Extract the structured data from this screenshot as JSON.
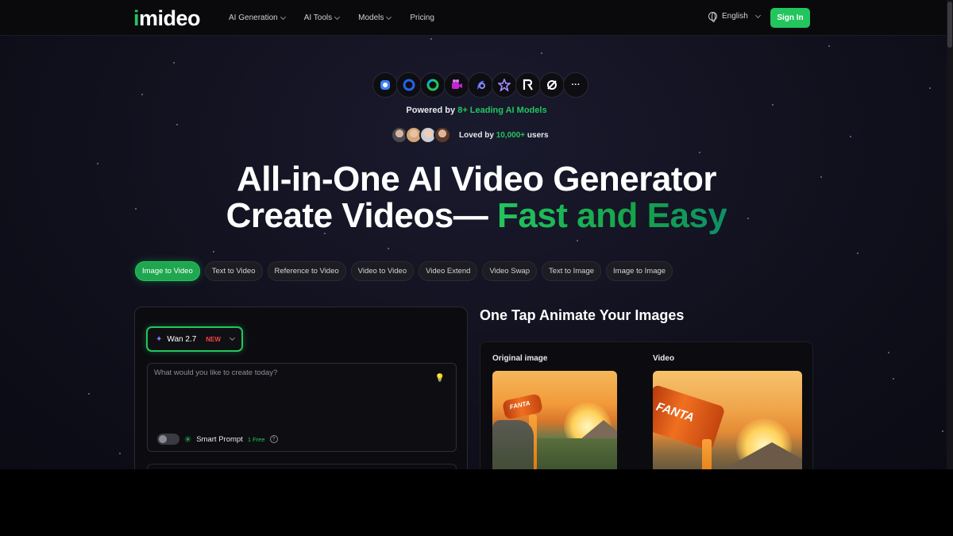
{
  "nav": {
    "logo": "imideo",
    "links": [
      {
        "label": "AI Generation",
        "dropdown": true
      },
      {
        "label": "AI Tools",
        "dropdown": true
      },
      {
        "label": "Models",
        "dropdown": true
      },
      {
        "label": "Pricing",
        "dropdown": false
      }
    ],
    "language": "English",
    "sign_in": "Sign In"
  },
  "hero": {
    "model_icons": [
      "hailuo-icon",
      "circle-icon",
      "kling-icon",
      "camera-icon",
      "pika-icon",
      "star-icon",
      "runway-icon",
      "luma-icon",
      "more-icon"
    ],
    "more_glyph": "···",
    "powered_prefix": "Powered by ",
    "powered_highlight": "8+ Leading AI Models",
    "loved_prefix": "Loved by ",
    "loved_highlight": "10,000+",
    "loved_suffix": " users",
    "title_line1": "All-in-One AI Video Generator",
    "title_line2_plain": "Create Videos— ",
    "title_line2_accent": "Fast and Easy"
  },
  "tabs": [
    {
      "label": "Image to Video",
      "active": true
    },
    {
      "label": "Text to Video",
      "active": false
    },
    {
      "label": "Reference to Video",
      "active": false
    },
    {
      "label": "Video to Video",
      "active": false
    },
    {
      "label": "Video Extend",
      "active": false
    },
    {
      "label": "Video Swap",
      "active": false
    },
    {
      "label": "Text to Image",
      "active": false
    },
    {
      "label": "Image to Image",
      "active": false
    }
  ],
  "generator": {
    "model_name": "Wan 2.7",
    "model_badge": "NEW",
    "prompt_placeholder": "What would you like to create today?",
    "smart_prompt_label": "Smart Prompt",
    "smart_prompt_free": "1 Free",
    "smart_prompt_enabled": false
  },
  "showcase": {
    "title": "One Tap Animate Your Images",
    "original_label": "Original image",
    "video_label": "Video",
    "can_text": "FANTA"
  },
  "colors": {
    "accent": "#22c55e",
    "new_badge": "#ef4444",
    "background": "#121220"
  }
}
